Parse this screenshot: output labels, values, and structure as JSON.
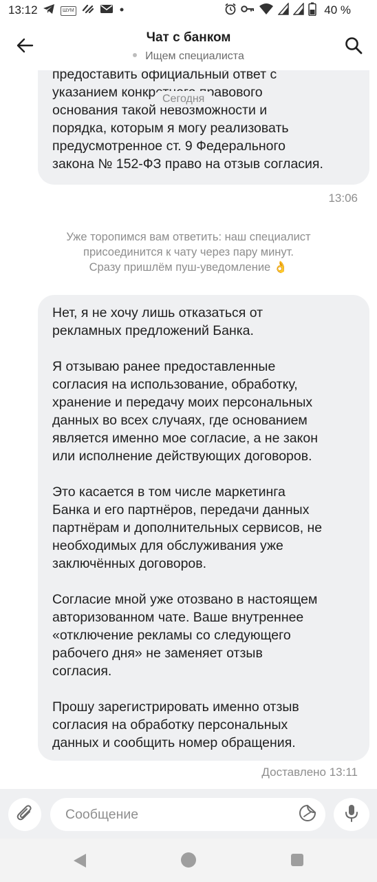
{
  "status_bar": {
    "time": "13:12",
    "battery_percent": "40 %",
    "left_icons": [
      "telegram-icon",
      "shum-icon",
      "chat-app-icon",
      "mail-icon",
      "dot-icon"
    ],
    "shum_label": "ШУМ",
    "right_icons": [
      "alarm-icon",
      "key-icon",
      "wifi-icon",
      "signal-icon",
      "signal-icon",
      "battery-icon"
    ]
  },
  "header": {
    "title": "Чат с банком",
    "status": "Ищем специалиста",
    "icons": {
      "back": "arrow-left-icon",
      "search": "search-icon"
    }
  },
  "chat": {
    "date_chip": "Сегодня",
    "message_1": {
      "lines": [
        "предоставить официальный ответ с",
        "указанием конкретного правового",
        "основания такой невозможности и",
        "порядка, которым я могу реализовать",
        "предусмотренное ст. 9 Федерального",
        "закона № 152-ФЗ право на отзыв согласия."
      ],
      "time": "13:06"
    },
    "system_note": {
      "lines": [
        "Уже торопимся вам ответить: наш специалист",
        "присоединится к чату через пару минут.",
        "Сразу пришлём пуш-уведомление"
      ],
      "emoji": "👌"
    },
    "message_2": {
      "paragraphs": [
        [
          "Нет, я не хочу лишь отказаться от",
          "рекламных предложений Банка."
        ],
        [
          "Я отзываю ранее предоставленные",
          "согласия на использование, обработку,",
          "хранение и передачу моих персональных",
          "данных во всех случаях, где основанием",
          "является именно мое согласие, а не закон",
          "или исполнение действующих договоров."
        ],
        [
          "Это касается в том числе маркетинга",
          "Банка и его партнёров, передачи данных",
          "партнёрам и дополнительных сервисов, не",
          "необходимых для обслуживания уже",
          "заключённых договоров."
        ],
        [
          "Согласие мной уже отозвано в настоящем",
          "авторизованном чате. Ваше внутреннее",
          "«отключение рекламы со следующего",
          "рабочего дня» не заменяет отзыв",
          "согласия."
        ],
        [
          "Прошу зарегистрировать именно отзыв",
          "согласия на обработку персональных",
          "данных и сообщить номер обращения."
        ]
      ],
      "status": "Доставлено 13:11"
    }
  },
  "composer": {
    "placeholder": "Сообщение",
    "value": "",
    "icons": {
      "attach": "paperclip-icon",
      "sticker": "sticker-icon",
      "mic": "microphone-icon"
    }
  },
  "nav_bar": {
    "icons": [
      "nav-back-icon",
      "nav-home-icon",
      "nav-recents-icon"
    ]
  },
  "colors": {
    "bubble_bg": "#eff0f2",
    "text_primary": "#1f1f1f",
    "text_secondary": "#8e8e8e",
    "composer_bg": "#eff0f2",
    "navbar_bg": "#f3f3f3"
  }
}
